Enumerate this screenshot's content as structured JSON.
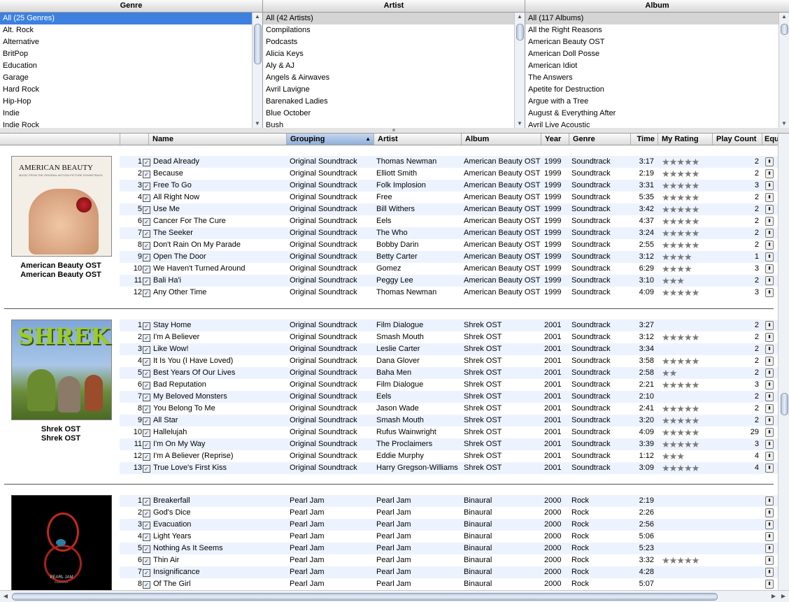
{
  "browser": {
    "genre": {
      "header": "Genre",
      "items": [
        "All (25 Genres)",
        "Alt. Rock",
        "Alternative",
        "BritPop",
        "Education",
        "Garage",
        "Hard Rock",
        "Hip-Hop",
        "Indie",
        "Indie Rock"
      ]
    },
    "artist": {
      "header": "Artist",
      "items": [
        "All (42 Artists)",
        "Compilations",
        "Podcasts",
        "Alicia Keys",
        "Aly & AJ",
        "Angels & Airwaves",
        "Avril Lavigne",
        "Barenaked Ladies",
        "Blue October",
        "Bush"
      ]
    },
    "album": {
      "header": "Album",
      "items": [
        "All (117 Albums)",
        "All the Right Reasons",
        "American Beauty OST",
        "American Doll Posse",
        "American Idiot",
        "The Answers",
        "Apetite for Destruction",
        "Argue with a Tree",
        "August & Everything After",
        "Avril Live Acoustic"
      ]
    }
  },
  "columns": {
    "name": "Name",
    "grouping": "Grouping",
    "artist": "Artist",
    "album": "Album",
    "year": "Year",
    "genre": "Genre",
    "time": "Time",
    "rating": "My Rating",
    "plays": "Play Count",
    "eq": "Equa"
  },
  "icons": {
    "checkbox": "checkbox-checked-icon",
    "sort": "sort-ascending-icon",
    "eq": "equalizer-preset-icon"
  },
  "groups": [
    {
      "caption1": "American Beauty OST",
      "caption2": "American Beauty OST",
      "art_title": "AMERICAN BEAUTY",
      "art_sub": "MUSIC FROM THE ORIGINAL MOTION PICTURE SOUNDTRACK",
      "tracks": [
        {
          "n": "1",
          "name": "Dead Already",
          "grouping": "Original Soundtrack",
          "artist": "Thomas Newman",
          "album": "American Beauty OST",
          "year": "1999",
          "genre": "Soundtrack",
          "time": "3:17",
          "stars": "★★★★★",
          "plays": "2"
        },
        {
          "n": "2",
          "name": "Because",
          "grouping": "Original Soundtrack",
          "artist": "Elliott Smith",
          "album": "American Beauty OST",
          "year": "1999",
          "genre": "Soundtrack",
          "time": "2:19",
          "stars": "★★★★★",
          "plays": "2"
        },
        {
          "n": "3",
          "name": "Free To Go",
          "grouping": "Original Soundtrack",
          "artist": "Folk Implosion",
          "album": "American Beauty OST",
          "year": "1999",
          "genre": "Soundtrack",
          "time": "3:31",
          "stars": "★★★★★",
          "plays": "3"
        },
        {
          "n": "4",
          "name": "All Right Now",
          "grouping": "Original Soundtrack",
          "artist": "Free",
          "album": "American Beauty OST",
          "year": "1999",
          "genre": "Soundtrack",
          "time": "5:35",
          "stars": "★★★★★",
          "plays": "2"
        },
        {
          "n": "5",
          "name": "Use Me",
          "grouping": "Original Soundtrack",
          "artist": "Bill Withers",
          "album": "American Beauty OST",
          "year": "1999",
          "genre": "Soundtrack",
          "time": "3:42",
          "stars": "★★★★★",
          "plays": "2"
        },
        {
          "n": "6",
          "name": "Cancer For The Cure",
          "grouping": "Original Soundtrack",
          "artist": "Eels",
          "album": "American Beauty OST",
          "year": "1999",
          "genre": "Soundtrack",
          "time": "4:37",
          "stars": "★★★★★",
          "plays": "2"
        },
        {
          "n": "7",
          "name": "The Seeker",
          "grouping": "Original Soundtrack",
          "artist": "The Who",
          "album": "American Beauty OST",
          "year": "1999",
          "genre": "Soundtrack",
          "time": "3:24",
          "stars": "★★★★★",
          "plays": "2"
        },
        {
          "n": "8",
          "name": "Don't Rain On My Parade",
          "grouping": "Original Soundtrack",
          "artist": "Bobby Darin",
          "album": "American Beauty OST",
          "year": "1999",
          "genre": "Soundtrack",
          "time": "2:55",
          "stars": "★★★★★",
          "plays": "2"
        },
        {
          "n": "9",
          "name": "Open The Door",
          "grouping": "Original Soundtrack",
          "artist": "Betty Carter",
          "album": "American Beauty OST",
          "year": "1999",
          "genre": "Soundtrack",
          "time": "3:12",
          "stars": "★★★★",
          "plays": "1"
        },
        {
          "n": "10",
          "name": "We Haven't Turned Around",
          "grouping": "Original Soundtrack",
          "artist": "Gomez",
          "album": "American Beauty OST",
          "year": "1999",
          "genre": "Soundtrack",
          "time": "6:29",
          "stars": "★★★★",
          "plays": "3"
        },
        {
          "n": "11",
          "name": "Bali Ha'i",
          "grouping": "Original Soundtrack",
          "artist": "Peggy Lee",
          "album": "American Beauty OST",
          "year": "1999",
          "genre": "Soundtrack",
          "time": "3:10",
          "stars": "★★★",
          "plays": "2"
        },
        {
          "n": "12",
          "name": "Any Other Time",
          "grouping": "Original Soundtrack",
          "artist": "Thomas Newman",
          "album": "American Beauty OST",
          "year": "1999",
          "genre": "Soundtrack",
          "time": "4:09",
          "stars": "★★★★★",
          "plays": "3"
        }
      ]
    },
    {
      "caption1": "Shrek OST",
      "caption2": "Shrek OST",
      "art_title": "SHREK",
      "art_sub": "",
      "tracks": [
        {
          "n": "1",
          "name": "Stay Home",
          "grouping": "Original Soundtrack",
          "artist": "Film Dialogue",
          "album": "Shrek OST",
          "year": "2001",
          "genre": "Soundtrack",
          "time": "3:27",
          "stars": "",
          "plays": "2"
        },
        {
          "n": "2",
          "name": "I'm A Believer",
          "grouping": "Original Soundtrack",
          "artist": "Smash Mouth",
          "album": "Shrek OST",
          "year": "2001",
          "genre": "Soundtrack",
          "time": "3:12",
          "stars": "★★★★★",
          "plays": "2"
        },
        {
          "n": "3",
          "name": "Like Wow!",
          "grouping": "Original Soundtrack",
          "artist": "Leslie Carter",
          "album": "Shrek OST",
          "year": "2001",
          "genre": "Soundtrack",
          "time": "3:34",
          "stars": "",
          "plays": "2"
        },
        {
          "n": "4",
          "name": "It Is You (I Have Loved)",
          "grouping": "Original Soundtrack",
          "artist": "Dana Glover",
          "album": "Shrek OST",
          "year": "2001",
          "genre": "Soundtrack",
          "time": "3:58",
          "stars": "★★★★★",
          "plays": "2"
        },
        {
          "n": "5",
          "name": "Best Years Of Our Lives",
          "grouping": "Original Soundtrack",
          "artist": "Baha Men",
          "album": "Shrek OST",
          "year": "2001",
          "genre": "Soundtrack",
          "time": "2:58",
          "stars": "★★",
          "plays": "2"
        },
        {
          "n": "6",
          "name": "Bad Reputation",
          "grouping": "Original Soundtrack",
          "artist": "Film Dialogue",
          "album": "Shrek OST",
          "year": "2001",
          "genre": "Soundtrack",
          "time": "2:21",
          "stars": "★★★★★",
          "plays": "3"
        },
        {
          "n": "7",
          "name": "My Beloved Monsters",
          "grouping": "Original Soundtrack",
          "artist": "Eels",
          "album": "Shrek OST",
          "year": "2001",
          "genre": "Soundtrack",
          "time": "2:10",
          "stars": "",
          "plays": "2"
        },
        {
          "n": "8",
          "name": "You Belong To Me",
          "grouping": "Original Soundtrack",
          "artist": "Jason Wade",
          "album": "Shrek OST",
          "year": "2001",
          "genre": "Soundtrack",
          "time": "2:41",
          "stars": "★★★★★",
          "plays": "2"
        },
        {
          "n": "9",
          "name": "All Star",
          "grouping": "Original Soundtrack",
          "artist": "Smash Mouth",
          "album": "Shrek OST",
          "year": "2001",
          "genre": "Soundtrack",
          "time": "3:20",
          "stars": "★★★★★",
          "plays": "2"
        },
        {
          "n": "10",
          "name": "Hallelujah",
          "grouping": "Original Soundtrack",
          "artist": "Rufus Wainwright",
          "album": "Shrek OST",
          "year": "2001",
          "genre": "Soundtrack",
          "time": "4:09",
          "stars": "★★★★★",
          "plays": "29"
        },
        {
          "n": "11",
          "name": "I'm On My Way",
          "grouping": "Original Soundtrack",
          "artist": "The Proclaimers",
          "album": "Shrek OST",
          "year": "2001",
          "genre": "Soundtrack",
          "time": "3:39",
          "stars": "★★★★★",
          "plays": "3"
        },
        {
          "n": "12",
          "name": "I'm A Believer (Reprise)",
          "grouping": "Original Soundtrack",
          "artist": "Eddie Murphy",
          "album": "Shrek OST",
          "year": "2001",
          "genre": "Soundtrack",
          "time": "1:12",
          "stars": "★★★",
          "plays": "4"
        },
        {
          "n": "13",
          "name": "True Love's First Kiss",
          "grouping": "Original Soundtrack",
          "artist": "Harry Gregson-Williams",
          "album": "Shrek OST",
          "year": "2001",
          "genre": "Soundtrack",
          "time": "3:09",
          "stars": "★★★★★",
          "plays": "4"
        }
      ]
    },
    {
      "caption1": "",
      "caption2": "",
      "art_title": "PEARL JAM",
      "art_sub": "BINAURAL",
      "tracks": [
        {
          "n": "1",
          "name": "Breakerfall",
          "grouping": "Pearl Jam",
          "artist": "Pearl Jam",
          "album": "Binaural",
          "year": "2000",
          "genre": "Rock",
          "time": "2:19",
          "stars": "",
          "plays": ""
        },
        {
          "n": "2",
          "name": "God's Dice",
          "grouping": "Pearl Jam",
          "artist": "Pearl Jam",
          "album": "Binaural",
          "year": "2000",
          "genre": "Rock",
          "time": "2:26",
          "stars": "",
          "plays": ""
        },
        {
          "n": "3",
          "name": "Evacuation",
          "grouping": "Pearl Jam",
          "artist": "Pearl Jam",
          "album": "Binaural",
          "year": "2000",
          "genre": "Rock",
          "time": "2:56",
          "stars": "",
          "plays": ""
        },
        {
          "n": "4",
          "name": "Light Years",
          "grouping": "Pearl Jam",
          "artist": "Pearl Jam",
          "album": "Binaural",
          "year": "2000",
          "genre": "Rock",
          "time": "5:06",
          "stars": "",
          "plays": ""
        },
        {
          "n": "5",
          "name": "Nothing As It Seems",
          "grouping": "Pearl Jam",
          "artist": "Pearl Jam",
          "album": "Binaural",
          "year": "2000",
          "genre": "Rock",
          "time": "5:23",
          "stars": "",
          "plays": ""
        },
        {
          "n": "6",
          "name": "Thin Air",
          "grouping": "Pearl Jam",
          "artist": "Pearl Jam",
          "album": "Binaural",
          "year": "2000",
          "genre": "Rock",
          "time": "3:32",
          "stars": "★★★★★",
          "plays": ""
        },
        {
          "n": "7",
          "name": "Insignificance",
          "grouping": "Pearl Jam",
          "artist": "Pearl Jam",
          "album": "Binaural",
          "year": "2000",
          "genre": "Rock",
          "time": "4:28",
          "stars": "",
          "plays": ""
        },
        {
          "n": "8",
          "name": "Of The Girl",
          "grouping": "Pearl Jam",
          "artist": "Pearl Jam",
          "album": "Binaural",
          "year": "2000",
          "genre": "Rock",
          "time": "5:07",
          "stars": "",
          "plays": ""
        }
      ]
    }
  ]
}
